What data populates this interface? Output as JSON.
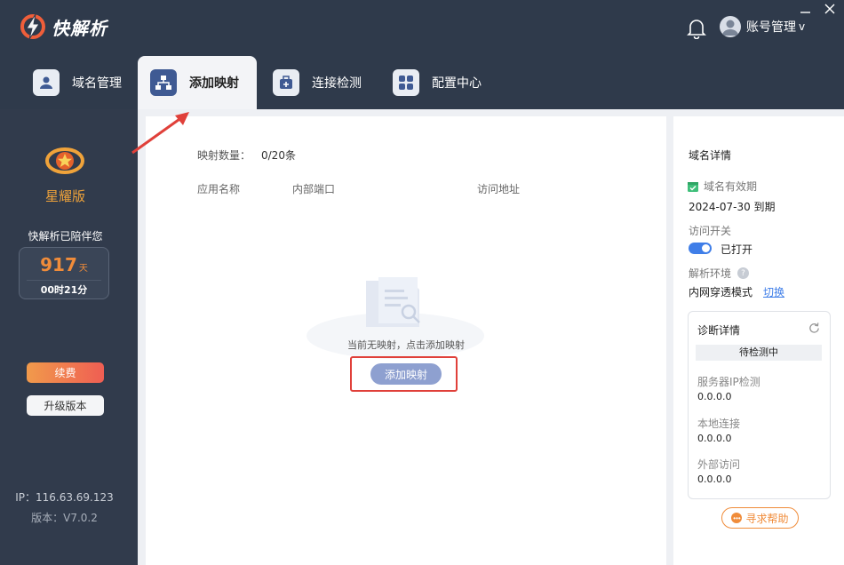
{
  "app": {
    "name": "快解析",
    "account_label": "账号管理",
    "account_caret": "v"
  },
  "tabs": [
    {
      "label": "域名管理",
      "icon": "user-card-icon",
      "active": false
    },
    {
      "label": "添加映射",
      "icon": "network-topology-icon",
      "active": true
    },
    {
      "label": "连接检测",
      "icon": "medical-kit-icon",
      "active": false
    },
    {
      "label": "配置中心",
      "icon": "grid-apps-icon",
      "active": false
    }
  ],
  "sidebar": {
    "edition": "星耀版",
    "companion_text": "快解析已陪伴您",
    "days": "917",
    "days_unit": "天",
    "duration": "00时21分",
    "renew_label": "续费",
    "upgrade_label": "升级版本",
    "ip": "IP：116.63.69.123",
    "version": "版本：V7.0.2"
  },
  "main": {
    "count_label": "映射数量：",
    "count_value": "0/20条",
    "columns": [
      "应用名称",
      "内部端口",
      "访问地址"
    ],
    "empty_text": "当前无映射，点击添加映射",
    "add_button": "添加映射"
  },
  "details": {
    "title": "域名详情",
    "validity_label": "域名有效期",
    "expire_date": "2024-07-30 到期",
    "access_label": "访问开关",
    "access_state": "已打开",
    "env_label": "解析环境",
    "env_value": "内网穿透模式",
    "switch_label": "切换",
    "diag": {
      "title": "诊断详情",
      "status": "待检测中",
      "items": [
        {
          "label": "服务器IP检测",
          "value": "0.0.0.0"
        },
        {
          "label": "本地连接",
          "value": "0.0.0.0"
        },
        {
          "label": "外部访问",
          "value": "0.0.0.0"
        }
      ]
    },
    "help_label": "寻求帮助"
  },
  "colors": {
    "header_bg": "#2f3a4b",
    "accent_blue": "#3f7ee8",
    "accent_orange": "#f08c3a",
    "highlight_red": "#e0403a"
  }
}
